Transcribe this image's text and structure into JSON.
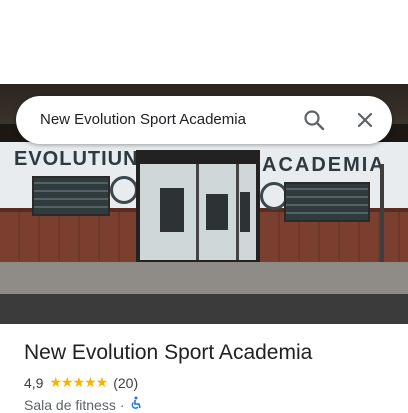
{
  "search": {
    "query": "New Evolution Sport Academia"
  },
  "photo": {
    "sign_left": "EVOLUTIUN",
    "sign_right": "ACADEMIA"
  },
  "place": {
    "name": "New Evolution Sport Academia",
    "rating": "4,9",
    "stars": "★★★★★",
    "review_count": "(20)",
    "category": "Sala de fitness",
    "separator": "·"
  },
  "icons": {
    "search": "search-icon",
    "close": "close-icon",
    "accessibility": "wheelchair-icon"
  },
  "colors": {
    "star": "#f4b400",
    "accessibility": "#1a73e8"
  }
}
